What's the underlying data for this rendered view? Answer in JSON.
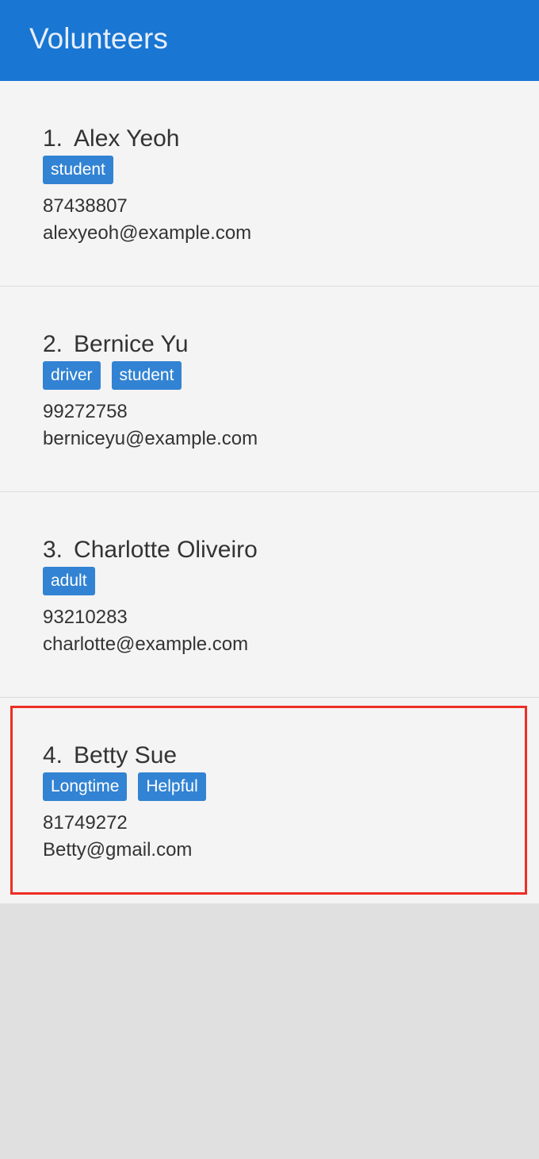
{
  "header": {
    "title": "Volunteers"
  },
  "volunteers": [
    {
      "index": "1.",
      "name": "Alex Yeoh",
      "tags": [
        "student"
      ],
      "phone": "87438807",
      "email": "alexyeoh@example.com"
    },
    {
      "index": "2.",
      "name": "Bernice Yu",
      "tags": [
        "driver",
        "student"
      ],
      "phone": "99272758",
      "email": "berniceyu@example.com"
    },
    {
      "index": "3.",
      "name": "Charlotte Oliveiro",
      "tags": [
        "adult"
      ],
      "phone": "93210283",
      "email": "charlotte@example.com"
    },
    {
      "index": "4.",
      "name": "Betty Sue",
      "tags": [
        "Longtime",
        "Helpful"
      ],
      "phone": "81749272",
      "email": "Betty@gmail.com",
      "highlighted": true
    }
  ],
  "colors": {
    "header_bg": "#1976d2",
    "tag_bg": "#3283d3",
    "card_bg": "#f4f4f4",
    "highlight_border": "#ee2e24",
    "empty_bg": "#e0e0e0"
  }
}
